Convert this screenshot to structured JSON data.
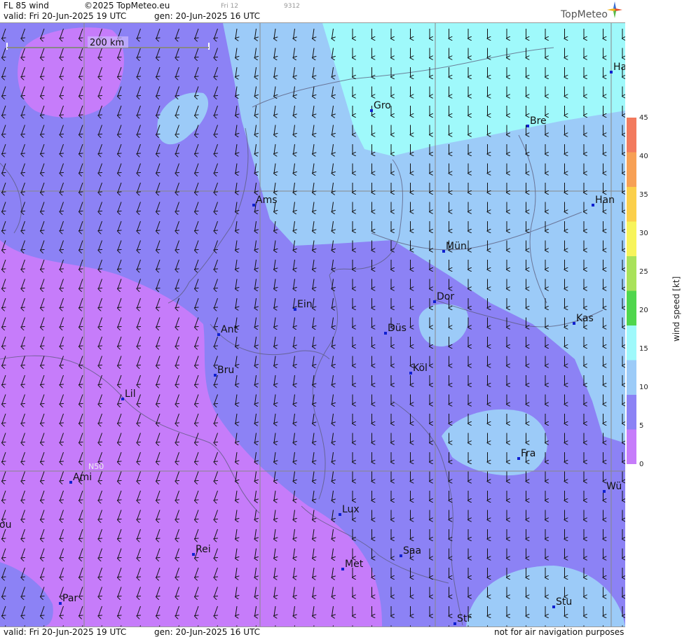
{
  "header": {
    "product": "FL 85 wind",
    "copyright": "©2025 TopMeteo.eu",
    "valid": "valid:  Fri   20-Jun-2025  19 UTC",
    "generated": "gen: 20-Jun-2025 16 UTC",
    "small_label_1": "Fri 12",
    "small_label_2": "9312",
    "brand": "TopMeteo"
  },
  "footer": {
    "valid": "valid:  Fri   20-Jun-2025  19 UTC",
    "generated": "gen: 20-Jun-2025 16 UTC",
    "disclaimer": "not for air navigation purposes"
  },
  "scale_bar": {
    "label": "200 km"
  },
  "graticule": {
    "label": "N50"
  },
  "colorbar": {
    "unit": "wind  speed  [kt]",
    "ticks": [
      "45",
      "40",
      "35",
      "30",
      "25",
      "20",
      "15",
      "10",
      "5",
      "0"
    ],
    "colors": [
      "#f27a5e",
      "#f7a055",
      "#fbcf4a",
      "#f7f45a",
      "#a9e25a",
      "#4fd64d",
      "#9ff9fb",
      "#9ccbf8",
      "#8c82f5",
      "#c67cfa"
    ]
  },
  "cities": [
    {
      "name": "Gro"
    },
    {
      "name": "Bre"
    },
    {
      "name": "Ha"
    },
    {
      "name": "Ams"
    },
    {
      "name": "Han"
    },
    {
      "name": "Mün"
    },
    {
      "name": "Dor"
    },
    {
      "name": "Ein"
    },
    {
      "name": "Kas"
    },
    {
      "name": "Düs"
    },
    {
      "name": "Ant"
    },
    {
      "name": "Köl"
    },
    {
      "name": "Bru"
    },
    {
      "name": "Lil"
    },
    {
      "name": "Fra"
    },
    {
      "name": "Ami"
    },
    {
      "name": "Wü"
    },
    {
      "name": "Lux"
    },
    {
      "name": "Rei"
    },
    {
      "name": "Saa"
    },
    {
      "name": "Met"
    },
    {
      "name": "Par"
    },
    {
      "name": "Stu"
    },
    {
      "name": "Str"
    },
    {
      "name": "ou"
    }
  ]
}
